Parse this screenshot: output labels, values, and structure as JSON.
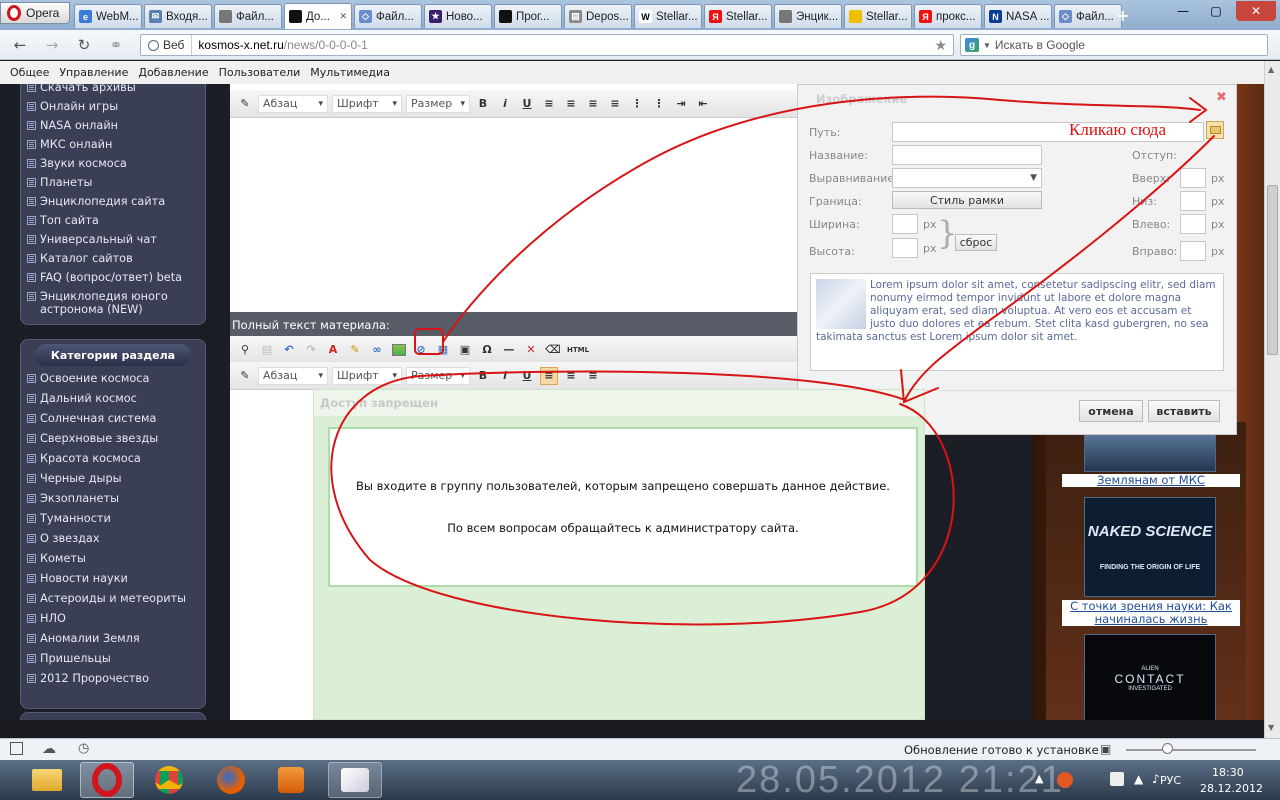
{
  "browser": {
    "menu_label": "Opera",
    "tabs": [
      {
        "label": "WebM...",
        "icon": "globe"
      },
      {
        "label": "Входя...",
        "icon": "mail"
      },
      {
        "label": "Файл...",
        "icon": "photo"
      },
      {
        "label": "До...",
        "icon": "space",
        "active": true
      },
      {
        "label": "Файл...",
        "icon": "circle"
      },
      {
        "label": "Ново...",
        "icon": "star"
      },
      {
        "label": "Прог...",
        "icon": "space"
      },
      {
        "label": "Depos...",
        "icon": "folder"
      },
      {
        "label": "Stellar...",
        "icon": "wikipedia"
      },
      {
        "label": "Stellar...",
        "icon": "yandex"
      },
      {
        "label": "Энцик...",
        "icon": "photo"
      },
      {
        "label": "Stellar...",
        "icon": "yellow"
      },
      {
        "label": "прокс...",
        "icon": "yandex"
      },
      {
        "label": "NASA ...",
        "icon": "nasa"
      },
      {
        "label": "Файл...",
        "icon": "circle"
      }
    ],
    "web_badge": "Веб",
    "url_domain": "kosmos-x.net.ru",
    "url_path": "/news/0-0-0-0-1",
    "search_placeholder": "Искать в Google",
    "status_text": "Обновление готово к установке"
  },
  "site_menu": [
    "Общее",
    "Управление",
    "Добавление",
    "Пользователи",
    "Мультимедиа"
  ],
  "sidebar_top": [
    "Скачать архивы",
    "Онлайн игры",
    "NASA онлайн",
    "МКС онлайн",
    "Звуки космоса",
    "Планеты",
    "Энциклопедия сайта",
    "Топ сайта",
    "Универсальный чат",
    "Каталог сайтов",
    "FAQ (вопрос/ответ) beta",
    "Энциклопедия юного астронома (NEW)"
  ],
  "categories_title": "Категории раздела",
  "categories": [
    "Освоение космоса",
    "Дальний космос",
    "Солнечная система",
    "Сверхновые звезды",
    "Красота космоса",
    "Черные дыры",
    "Экзопланеты",
    "Туманности",
    "О звездах",
    "Кометы",
    "Новости науки",
    "Астероиды и метеориты",
    "НЛО",
    "Аномалии Земля",
    "Пришельцы",
    "2012 Пророчество"
  ],
  "editor": {
    "paragraph_label": "Абзац",
    "font_label": "Шрифт",
    "size_label": "Размер",
    "full_text_label": "Полный текст материала:"
  },
  "image_dialog": {
    "title": "Изображение",
    "path_label": "Путь:",
    "name_label": "Название:",
    "align_label": "Выравнивание:",
    "border_label": "Граница:",
    "border_button": "Стиль рамки",
    "width_label": "Ширина:",
    "height_label": "Высота:",
    "reset_button": "сброс",
    "indent_label": "Отступ:",
    "top_label": "Вверх:",
    "bottom_label": "Низ:",
    "left_label": "Влево:",
    "right_label": "Вправо:",
    "unit": "px",
    "preview_text": "Lorem ipsum dolor sit amet, consetetur sadipscing elitr, sed diam nonumy eirmod tempor invidunt ut labore et dolore magna aliquyam erat, sed diam voluptua. At vero eos et accusam et justo duo dolores et ea rebum. Stet clita kasd gubergren, no sea takimata sanctus est Lorem ipsum dolor sit amet.",
    "cancel_button": "отмена",
    "insert_button": "вставить"
  },
  "annotation": {
    "click_here": "Кликаю сюда"
  },
  "denied_dialog": {
    "title": "Доступ запрещен",
    "line1": "Вы входите в группу пользователей, которым запрещено совершать данное действие.",
    "line2": "По всем вопросам обращайтесь к администратору сайта."
  },
  "right_column": {
    "caption1": "Землянам от МКС",
    "image2_title": "NAKED SCIENCE",
    "image2_subtitle": "FINDING THE ORIGIN OF LIFE",
    "caption2": "С точки зрения науки: Как начиналась жизнь",
    "image3_title": "CONTACT",
    "image3_super": "ALIEN",
    "image3_sub": "INVESTIGATED"
  },
  "taskbar": {
    "watermark": "28.05.2012 21:21",
    "lang": "РУС",
    "time": "18:30",
    "date": "28.12.2012"
  }
}
